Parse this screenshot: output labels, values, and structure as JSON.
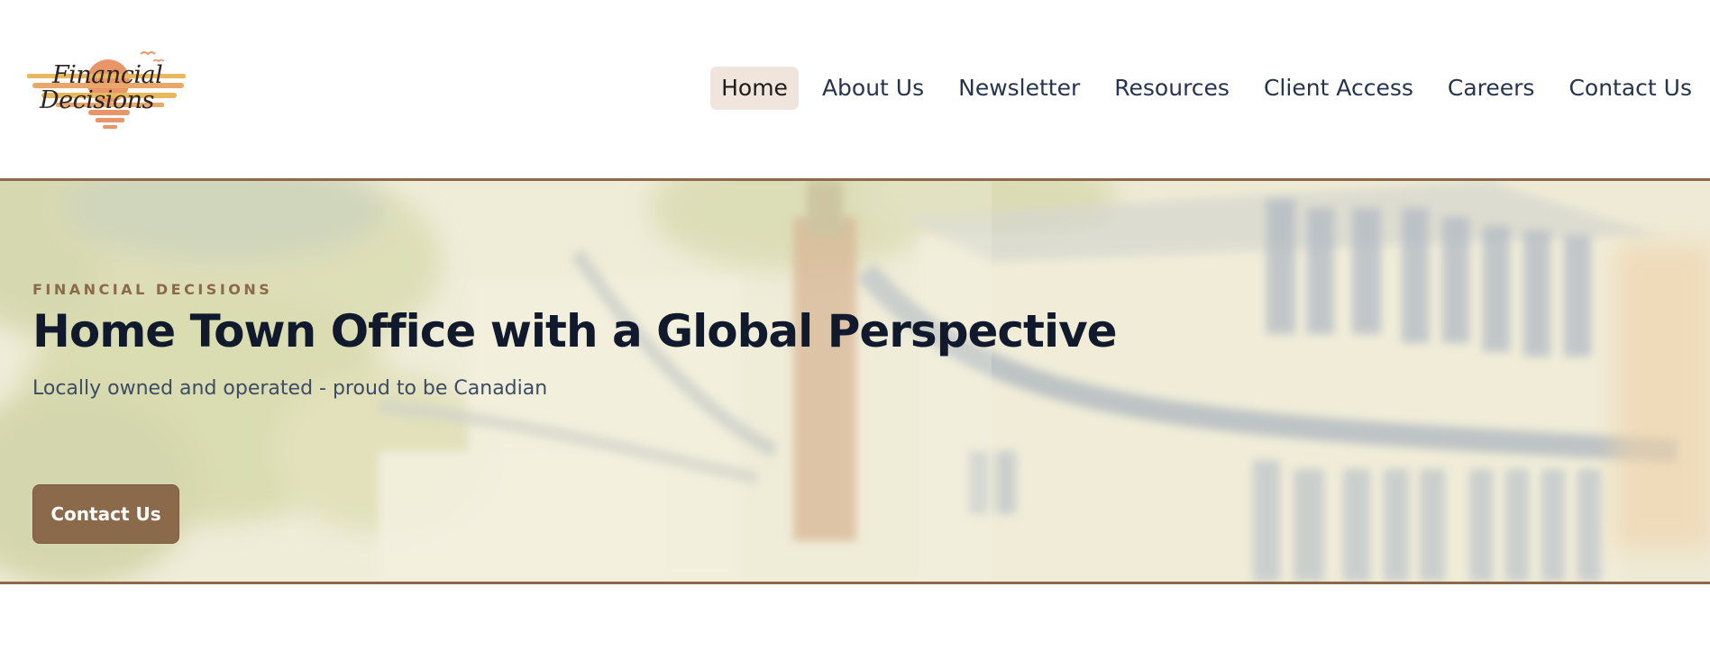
{
  "header": {
    "logo": {
      "line1": "Financial",
      "line2": "Decisions"
    },
    "nav": {
      "items": [
        {
          "label": "Home",
          "active": true
        },
        {
          "label": "About Us",
          "active": false
        },
        {
          "label": "Newsletter",
          "active": false
        },
        {
          "label": "Resources",
          "active": false
        },
        {
          "label": "Client Access",
          "active": false
        },
        {
          "label": "Careers",
          "active": false
        },
        {
          "label": "Contact Us",
          "active": false
        }
      ]
    }
  },
  "hero": {
    "eyebrow": "FINANCIAL DECISIONS",
    "title": "Home Town Office with a Global Perspective",
    "subtitle": "Locally owned and operated - proud to be Canadian",
    "cta_label": "Contact Us"
  },
  "colors": {
    "brand_brown": "#8b6a4b",
    "nav_active_bg": "#efe5dd",
    "nav_text": "#26344d",
    "title_text": "#111a2c",
    "subtitle_text": "#3d4b63",
    "logo_sun": "#e9956a",
    "logo_stripes": "#e8b85e"
  },
  "icons": {
    "logo_image": "sunset-logo-icon",
    "hero_image": "watercolor-house-illustration"
  }
}
